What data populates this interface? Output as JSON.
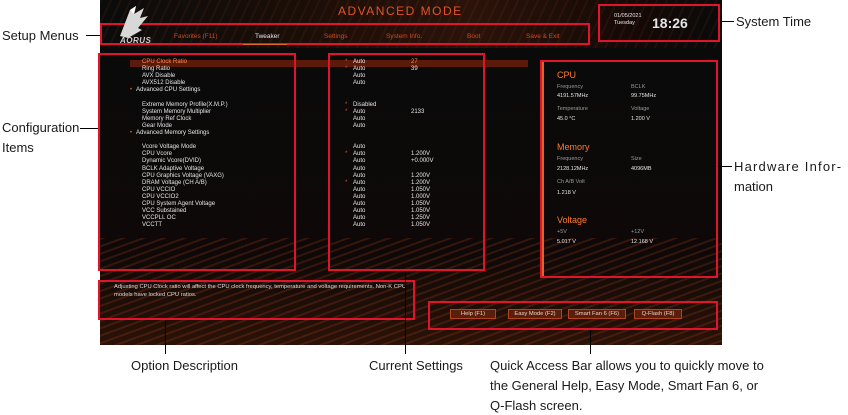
{
  "bios": {
    "brand": "AORUS",
    "mode_title": "ADVANCED MODE",
    "tabs": [
      "Favorites (F11)",
      "Tweaker",
      "Settings",
      "System Info.",
      "Boot",
      "Save & Exit"
    ],
    "active_tab": "Tweaker",
    "date_line1": "01/05/2021",
    "date_line2": "Tuesday",
    "time": "18:26"
  },
  "settings_rows": [
    {
      "label": "CPU Clock Ratio",
      "star": true,
      "value": "Auto",
      "extra": "27",
      "highlight": true
    },
    {
      "label": "Ring Ratio",
      "star": true,
      "value": "Auto",
      "extra": "39"
    },
    {
      "label": "AVX Disable",
      "star": false,
      "value": "Auto",
      "extra": ""
    },
    {
      "label": "AVX512 Disable",
      "star": false,
      "value": "Auto",
      "extra": ""
    },
    {
      "label": "Advanced CPU Settings",
      "submenu": true
    },
    {
      "label": "",
      "spacer": true
    },
    {
      "label": "Extreme Memory Profile(X.M.P.)",
      "star": true,
      "value": "Disabled",
      "extra": ""
    },
    {
      "label": "System Memory Multiplier",
      "star": true,
      "value": "Auto",
      "extra": "2133"
    },
    {
      "label": "Memory Ref Clock",
      "star": false,
      "value": "Auto",
      "extra": ""
    },
    {
      "label": "Gear Mode",
      "star": false,
      "value": "Auto",
      "extra": ""
    },
    {
      "label": "Advanced Memory Settings",
      "submenu": true
    },
    {
      "label": "",
      "spacer": true
    },
    {
      "label": "Vcore Voltage Mode",
      "star": false,
      "value": "Auto",
      "extra": ""
    },
    {
      "label": "CPU Vcore",
      "star": true,
      "value": "Auto",
      "extra": "1.200V"
    },
    {
      "label": "Dynamic Vcore(DVID)",
      "star": false,
      "value": "Auto",
      "extra": "+0.000V"
    },
    {
      "label": "BCLK Adaptive Voltage",
      "star": false,
      "value": "Auto",
      "extra": ""
    },
    {
      "label": "CPU Graphics Voltage (VAXG)",
      "star": false,
      "value": "Auto",
      "extra": "1.200V"
    },
    {
      "label": "DRAM Voltage    (CH A/B)",
      "star": true,
      "value": "Auto",
      "extra": "1.200V"
    },
    {
      "label": "CPU VCCIO",
      "star": false,
      "value": "Auto",
      "extra": "1.050V"
    },
    {
      "label": "CPU VCCIO2",
      "star": false,
      "value": "Auto",
      "extra": "1.000V"
    },
    {
      "label": "CPU System Agent Voltage",
      "star": false,
      "value": "Auto",
      "extra": "1.050V"
    },
    {
      "label": "VCC Substained",
      "star": false,
      "value": "Auto",
      "extra": "1.050V"
    },
    {
      "label": "VCCPLL OC",
      "star": false,
      "value": "Auto",
      "extra": "1.250V"
    },
    {
      "label": "VCCTT",
      "star": false,
      "value": "Auto",
      "extra": "1.050V"
    }
  ],
  "hardware": {
    "cpu_title": "CPU",
    "freq_label": "Frequency",
    "freq_value": "4191.57MHz",
    "bclk_label": "BCLK",
    "bclk_value": "99.75MHz",
    "temp_label": "Temperature",
    "temp_value": "45.0 °C",
    "volt_label": "Voltage",
    "volt_value": "1.200 V",
    "mem_title": "Memory",
    "mem_freq_label": "Frequency",
    "mem_freq_value": "2128.12MHz",
    "size_label": "Size",
    "size_value": "4096MB",
    "chab_label": "Ch A/B Volt",
    "chab_value": "1.218 V",
    "volt_title": "Voltage",
    "v5_label": "+5V",
    "v5_value": "5.017 V",
    "v12_label": "+12V",
    "v12_value": "12.168 V"
  },
  "description": "Adjusting CPU Clock ratio will affect the CPU clock frequency, temperature and voltage requirements. Non-K CPU models have locked CPU ratios.",
  "quick_access": [
    "Help (F1)",
    "Easy Mode (F2)",
    "Smart Fan 6 (F6)",
    "Q-Flash (F8)"
  ],
  "callouts": {
    "setup_menus": "Setup Menus",
    "system_time": "System Time",
    "config_items_1": "Configuration",
    "config_items_2": "Items",
    "hw_info_1": "Hardware Infor-",
    "hw_info_2": "mation",
    "option_desc": "Option Description",
    "current_settings": "Current Settings",
    "quick_bar_1": "Quick Access Bar allows you to quickly move to",
    "quick_bar_2": "the General Help, Easy Mode, Smart Fan 6, or",
    "quick_bar_3": "Q-Flash screen."
  },
  "colors": {
    "accent": "#e0542a",
    "callout": "#e0142a"
  }
}
